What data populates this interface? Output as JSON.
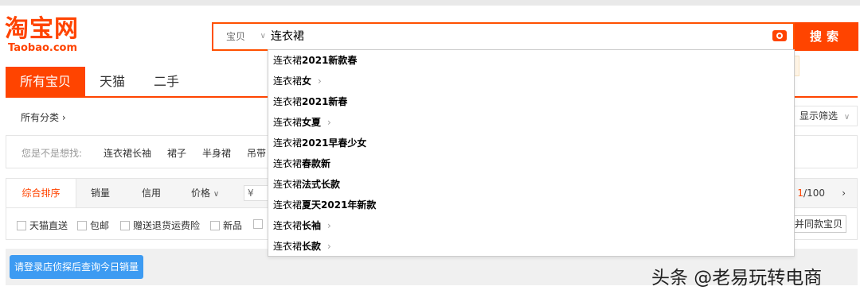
{
  "logo": {
    "cn": "淘宝网",
    "en": "Taobao.com"
  },
  "search": {
    "scope": "宝贝",
    "query": "连衣裙",
    "button": "搜索"
  },
  "tabs": [
    "所有宝贝",
    "天猫",
    "二手"
  ],
  "breadcrumb": "所有分类",
  "filter_toggle": "显示筛选",
  "did_you_mean": {
    "label": "您是不是想找:",
    "items": [
      "连衣裙长袖",
      "裙子",
      "半身裙",
      "吊带"
    ]
  },
  "sort": {
    "items": [
      "综合排序",
      "销量",
      "信用",
      "价格"
    ],
    "price_placeholder": "¥",
    "page_current": "1",
    "page_total": "/100"
  },
  "checkboxes": [
    "天猫直送",
    "包邮",
    "赠送退货运费险",
    "新品"
  ],
  "merge_button": "并同款宝贝",
  "login_button": "请登录店侦探后查询今日销量",
  "suggestions": [
    {
      "prefix": "连衣裙",
      "suffix": "2021新款春",
      "arrow": false
    },
    {
      "prefix": "连衣裙",
      "suffix": "女",
      "arrow": true
    },
    {
      "prefix": "连衣裙",
      "suffix": "2021新春",
      "arrow": false
    },
    {
      "prefix": "连衣裙",
      "suffix": "女夏",
      "arrow": true
    },
    {
      "prefix": "连衣裙",
      "suffix": "2021早春少女",
      "arrow": false
    },
    {
      "prefix": "连衣裙",
      "suffix": "春款新",
      "arrow": false
    },
    {
      "prefix": "连衣裙",
      "suffix": "法式长款",
      "arrow": false
    },
    {
      "prefix": "连衣裙",
      "suffix": "夏天2021年新款",
      "arrow": false
    },
    {
      "prefix": "连衣裙",
      "suffix": "长袖",
      "arrow": true
    },
    {
      "prefix": "连衣裙",
      "suffix": "长款",
      "arrow": true
    }
  ],
  "watermark": "头条 @老易玩转电商",
  "colors": {
    "brand": "#ff4400",
    "login": "#3d9bf2"
  }
}
